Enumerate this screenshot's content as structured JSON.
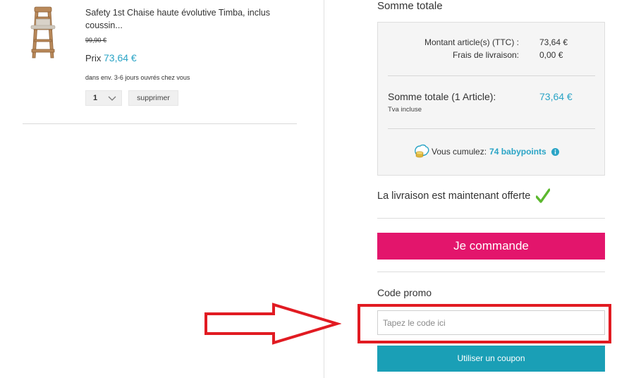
{
  "cart_item": {
    "title": "Safety 1st Chaise haute évolutive Timba, inclus coussin...",
    "old_price": "99,90 €",
    "price_label": "Prix ",
    "price_value": "73,64 €",
    "delivery_text": "dans env. 3-6 jours ouvrés chez vous",
    "quantity": "1",
    "remove_label": "supprimer"
  },
  "summary": {
    "title": "Somme totale",
    "articles_label": "Montant article(s) (TTC) :",
    "articles_value": "73,64 €",
    "shipping_label": "Frais de livraison:",
    "shipping_value": "0,00 €",
    "total_label": "Somme totale (1 Article):",
    "total_value": "73,64 €",
    "tva_note": "Tva incluse",
    "babypoints_text": "Vous cumulez:",
    "babypoints_value": "74 babypoints"
  },
  "free_shipping_text": "La livraison est maintenant offerte",
  "order_button_label": "Je commande",
  "promo": {
    "label": "Code promo",
    "input_value": "",
    "input_placeholder": "Tapez le code ici",
    "coupon_button_label": "Utiliser un coupon"
  },
  "colors": {
    "accent_blue": "#2aa4c6",
    "order_pink": "#e3156c",
    "coupon_teal": "#1a9fb6",
    "annotation_red": "#e11b22",
    "check_green": "#5cb82f"
  },
  "icons": [
    "high-chair-product-image",
    "chevron-down-icon",
    "coins-icon",
    "info-icon",
    "check-icon",
    "annotation-arrow"
  ]
}
